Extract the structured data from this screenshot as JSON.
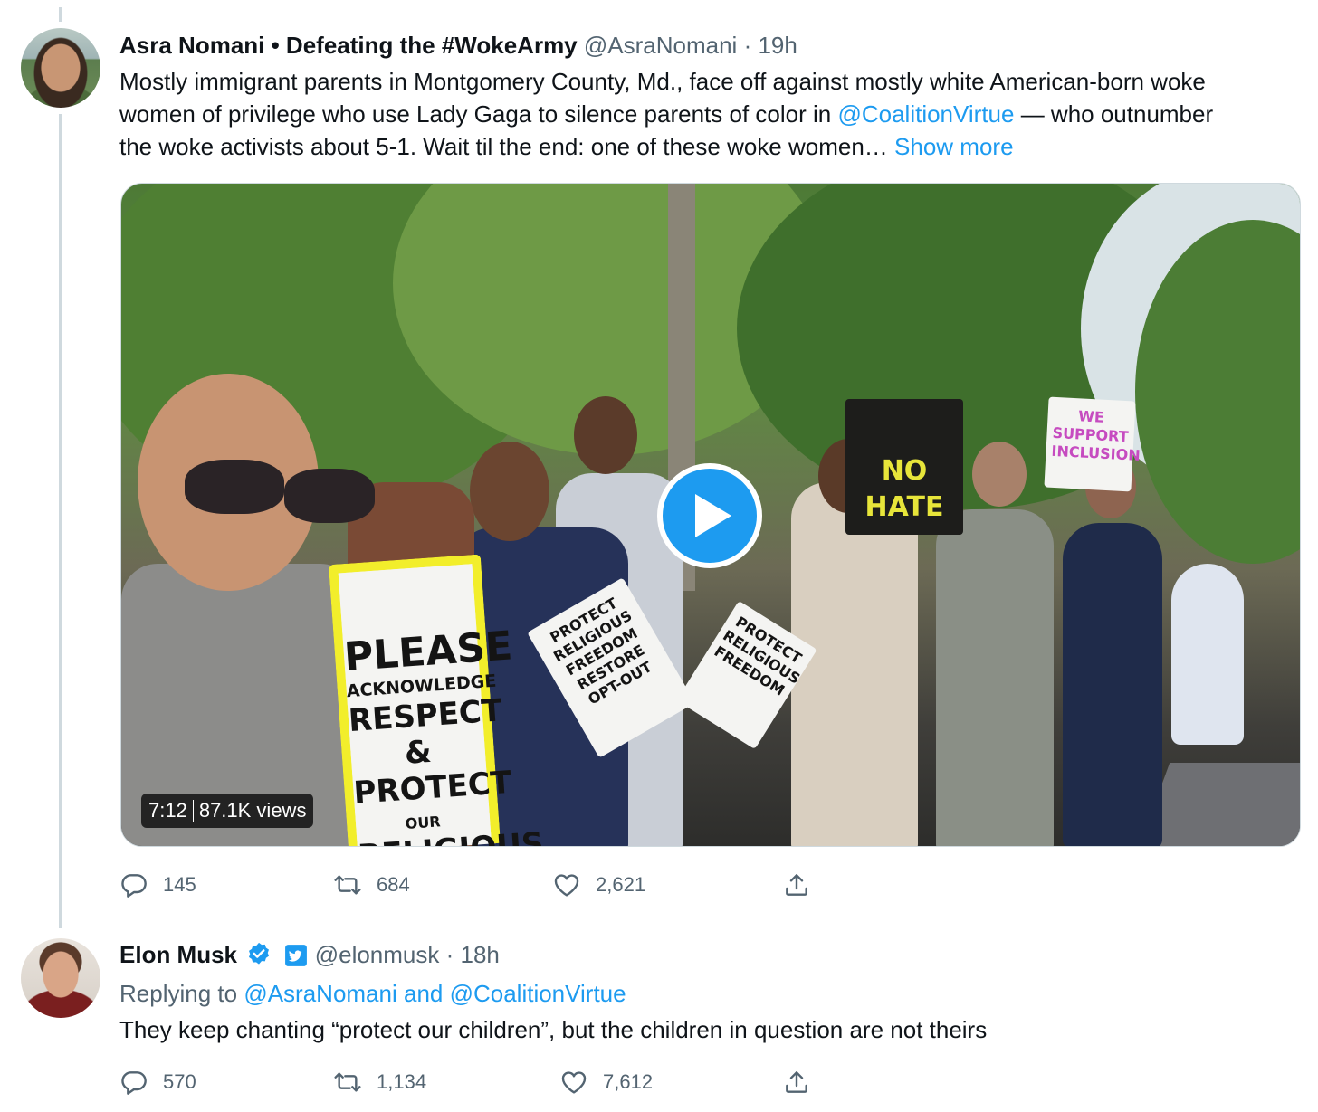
{
  "tweets": [
    {
      "author_name": "Asra Nomani • Defeating the #WokeArmy",
      "handle": "@AsraNomani",
      "time": "· 19h",
      "text_line1": "Mostly immigrant parents in Montgomery County, Md., face off against mostly white American-born woke",
      "text_line2_a": "women of privilege who use Lady Gaga to silence parents of color in ",
      "text_line2_link": "@CoalitionVirtue",
      "text_line2_b": " — who outnumber",
      "text_line3": "the woke activists about 5-1. Wait til the end: one of these woke women… ",
      "show_more": "Show more",
      "video": {
        "duration": "7:12",
        "views": "87.1K views",
        "signs": {
          "main": [
            "PLEASE",
            "ACKNOWLEDGE",
            "RESPECT &",
            "PROTECT",
            "OUR",
            "RELIGIOUS"
          ],
          "protect": "PROTECT RELIGIOUS FREEDOM",
          "restore": "RESTORE OPT-OUT",
          "support": "WE SUPPORT INCLUSION"
        }
      },
      "replies": "145",
      "retweets": "684",
      "likes": "2,621",
      "icons": [
        "reply-icon",
        "retweet-icon",
        "like-icon",
        "share-icon"
      ]
    },
    {
      "author_name": "Elon Musk",
      "handle": "@elonmusk",
      "time": "· 18h",
      "badges": [
        "verified-badge-icon",
        "twitter-badge-icon"
      ],
      "replying_label": "Replying to ",
      "replying_to": "@AsraNomani and @CoalitionVirtue",
      "text": "They keep chanting “protect our children”, but the children in question are not theirs",
      "replies": "570",
      "retweets": "1,134",
      "likes": "7,612",
      "icons": [
        "reply-icon",
        "retweet-icon",
        "like-icon",
        "share-icon"
      ]
    }
  ],
  "colors": {
    "accent": "#1d9bf0",
    "text": "#0f1419",
    "muted": "#536471",
    "thread_line": "#cfd9de",
    "sign_yellow": "#f2ee2b"
  }
}
